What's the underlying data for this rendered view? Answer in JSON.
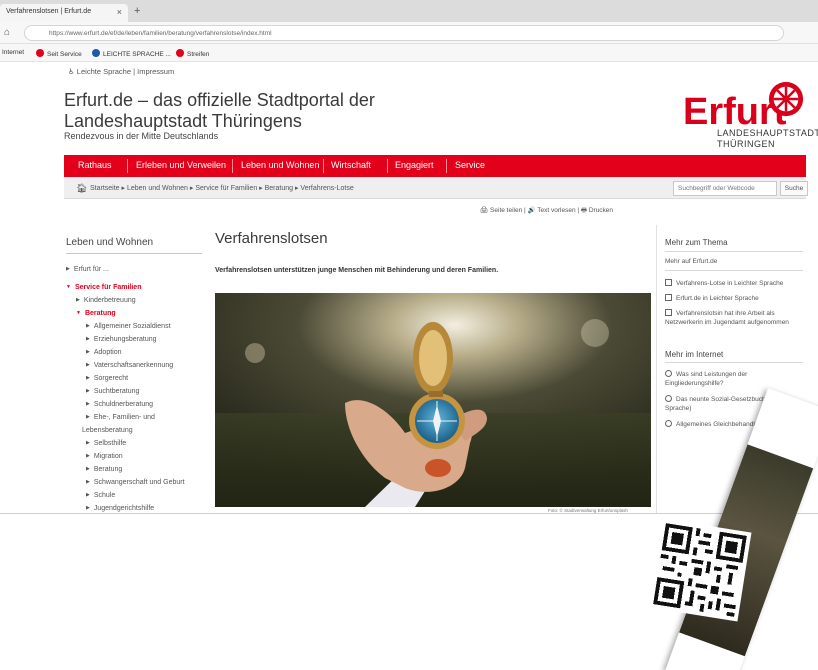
{
  "browser": {
    "tab_title": "Verfahrenslotsen | Erfurt.de",
    "tab_close": "×",
    "new_tab": "+",
    "url": "https://www.erfurt.de/ef/de/leben/familien/beratung/verfahrenslotse/index.html",
    "bookmarks": [
      {
        "label": "Internet",
        "color": "#888888"
      },
      {
        "label": "Seit Service",
        "color": "#e2001a"
      },
      {
        "label": "LEICHTE SPRACHE ...",
        "color": "#1f5aa6"
      },
      {
        "label": "Streifen",
        "color": "#e2001a"
      }
    ]
  },
  "header": {
    "service_links": "♿ Leichte Sprache | Impressum",
    "title": "Erfurt.de – das offizielle Stadtportal der Landeshauptstadt Thüringens",
    "subtitle": "Rendezvous in der Mitte Deutschlands",
    "logo_word": "Erfurt",
    "logo_line1": "LANDESHAUPTSTADT",
    "logo_line2": "THÜRINGEN",
    "brand_color": "#e2001a"
  },
  "mainnav": [
    "Rathaus",
    "Erleben und Verweilen",
    "Leben und Wohnen",
    "Wirtschaft",
    "Engagiert",
    "Service"
  ],
  "breadcrumb": {
    "items": "Startseite ▸ Leben und Wohnen ▸ Service für Familien ▸ Beratung ▸ Verfahrens-Lotse",
    "search_placeholder": "Suchbegriff oder Webcode",
    "search_button": "Suche"
  },
  "tools": "🖨 Seite teilen | 🔊 Text vorlesen | 🖶 Drucken",
  "leftnav": {
    "title": "Leben und Wohnen",
    "items": [
      {
        "label": "Erfurt für ...",
        "level": 0,
        "active": false
      },
      {
        "label": "Service für Familien",
        "level": 0,
        "active": true
      },
      {
        "label": "Kinderbetreuung",
        "level": 1,
        "active": false
      },
      {
        "label": "Beratung",
        "level": 1,
        "active": true
      },
      {
        "label": "Allgemeiner Sozialdienst",
        "level": 2,
        "active": false
      },
      {
        "label": "Erziehungsberatung",
        "level": 2,
        "active": false
      },
      {
        "label": "Adoption",
        "level": 2,
        "active": false
      },
      {
        "label": "Vaterschaftsanerkennung",
        "level": 2,
        "active": false
      },
      {
        "label": "Sorgerecht",
        "level": 2,
        "active": false
      },
      {
        "label": "Suchtberatung",
        "level": 2,
        "active": false
      },
      {
        "label": "Schuldnerberatung",
        "level": 2,
        "active": false
      },
      {
        "label": "Ehe-, Familien- und",
        "level": 2,
        "active": false
      },
      {
        "label": "Lebensberatung",
        "level": 3,
        "active": false
      },
      {
        "label": "Selbsthilfe",
        "level": 2,
        "active": false
      },
      {
        "label": "Migration",
        "level": 2,
        "active": false
      },
      {
        "label": "Beratung",
        "level": 2,
        "active": false
      },
      {
        "label": "Schwangerschaft und Geburt",
        "level": 2,
        "active": false
      },
      {
        "label": "Schule",
        "level": 2,
        "active": false
      },
      {
        "label": "Jugendgerichtshilfe",
        "level": 2,
        "active": false
      }
    ]
  },
  "main": {
    "heading": "Verfahrenslotsen",
    "intro": "Verfahrenslotsen unterstützen junge Menschen mit Behinderung und deren Familien.",
    "caption": "Foto: © Stadtverwaltung Erfurt/unsplash"
  },
  "right": {
    "head1": "Mehr zum Thema",
    "sub1": "Mehr auf Erfurt.de",
    "links1": [
      "Verfahrens-Lotse in Leichter Sprache",
      "Erfurt.de in Leichter Sprache",
      "Verfahrenslotsin hat ihre Arbeit als Netzwerkerin im Jugendamt aufgenommen"
    ],
    "head2": "Mehr im Internet",
    "links2": [
      "Was sind Leistungen der Eingliederungshilfe?",
      "Das neunte Sozial-Gesetzbuch (leichte Sprache)",
      "Allgemeines Gleichbehandlungs-Gesetz"
    ]
  }
}
